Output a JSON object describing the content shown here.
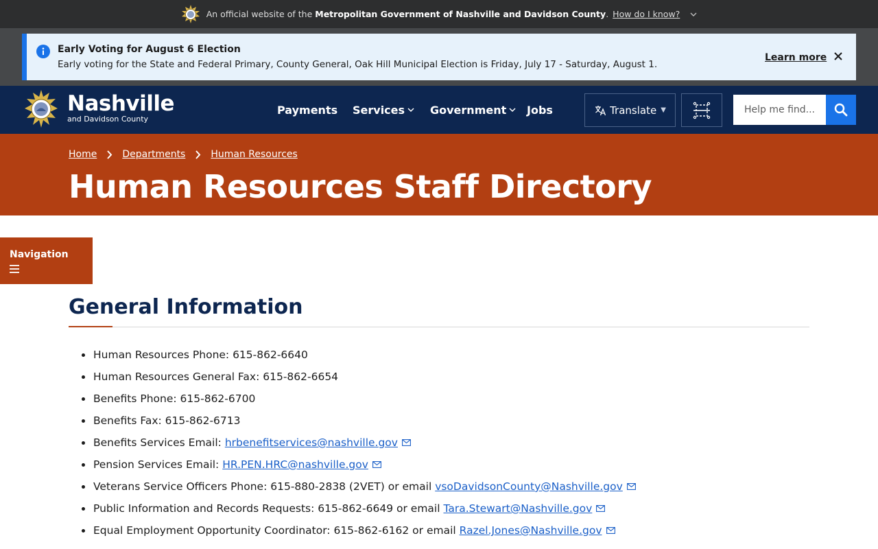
{
  "gov_banner": {
    "prefix": "An official website of the",
    "org": "Metropolitan Government of Nashville and Davidson County",
    "period": ".",
    "how_link": "How do I know?"
  },
  "alert": {
    "title": "Early Voting for August 6 Election",
    "body": "Early voting for the State and Federal Primary, County General, Oak Hill Municipal Election is Friday, July 17 - Saturday, August 1.",
    "learn_more": "Learn more"
  },
  "header": {
    "brand_name": "Nashville",
    "brand_sub": "and Davidson County",
    "nav": [
      {
        "label": "Payments"
      },
      {
        "label": "Services"
      },
      {
        "label": "Government"
      },
      {
        "label": "Jobs"
      }
    ],
    "translate_label": "Translate",
    "search_placeholder": "Help me find..."
  },
  "title_band": {
    "breadcrumb": [
      "Home",
      "Departments",
      "Human Resources"
    ],
    "page_title": "Human Resources Staff Directory"
  },
  "navigation_toggle": "Navigation",
  "content": {
    "section_title": "General Information",
    "items": [
      {
        "text": "Human Resources Phone: 615-862-6640"
      },
      {
        "text": "Human Resources General Fax: 615-862-6654"
      },
      {
        "text": "Benefits Phone: 615-862-6700"
      },
      {
        "text": "Benefits Fax: 615-862-6713"
      },
      {
        "text": "Benefits Services Email: ",
        "link": "hrbenefitservices@nashville.gov"
      },
      {
        "text": "Pension Services Email: ",
        "link": "HR.PEN.HRC@nashville.gov"
      },
      {
        "text": "Veterans Service Officers Phone: 615-880-2838 (2VET) or email ",
        "link": "vsoDavidsonCounty@Nashville.gov"
      },
      {
        "text": "Public Information and Records Requests: 615-862-6649 or email ",
        "link": "Tara.Stewart@Nashville.gov"
      },
      {
        "text": "Equal Employment Opportunity Coordinator: 615-862-6162 or email ",
        "link": "Razel.Jones@Nashville.gov"
      }
    ]
  },
  "colors": {
    "header_navy": "#0d2650",
    "accent_orange": "#b23f12",
    "link_blue": "#1a5fc8",
    "button_blue": "#1a73e8"
  }
}
